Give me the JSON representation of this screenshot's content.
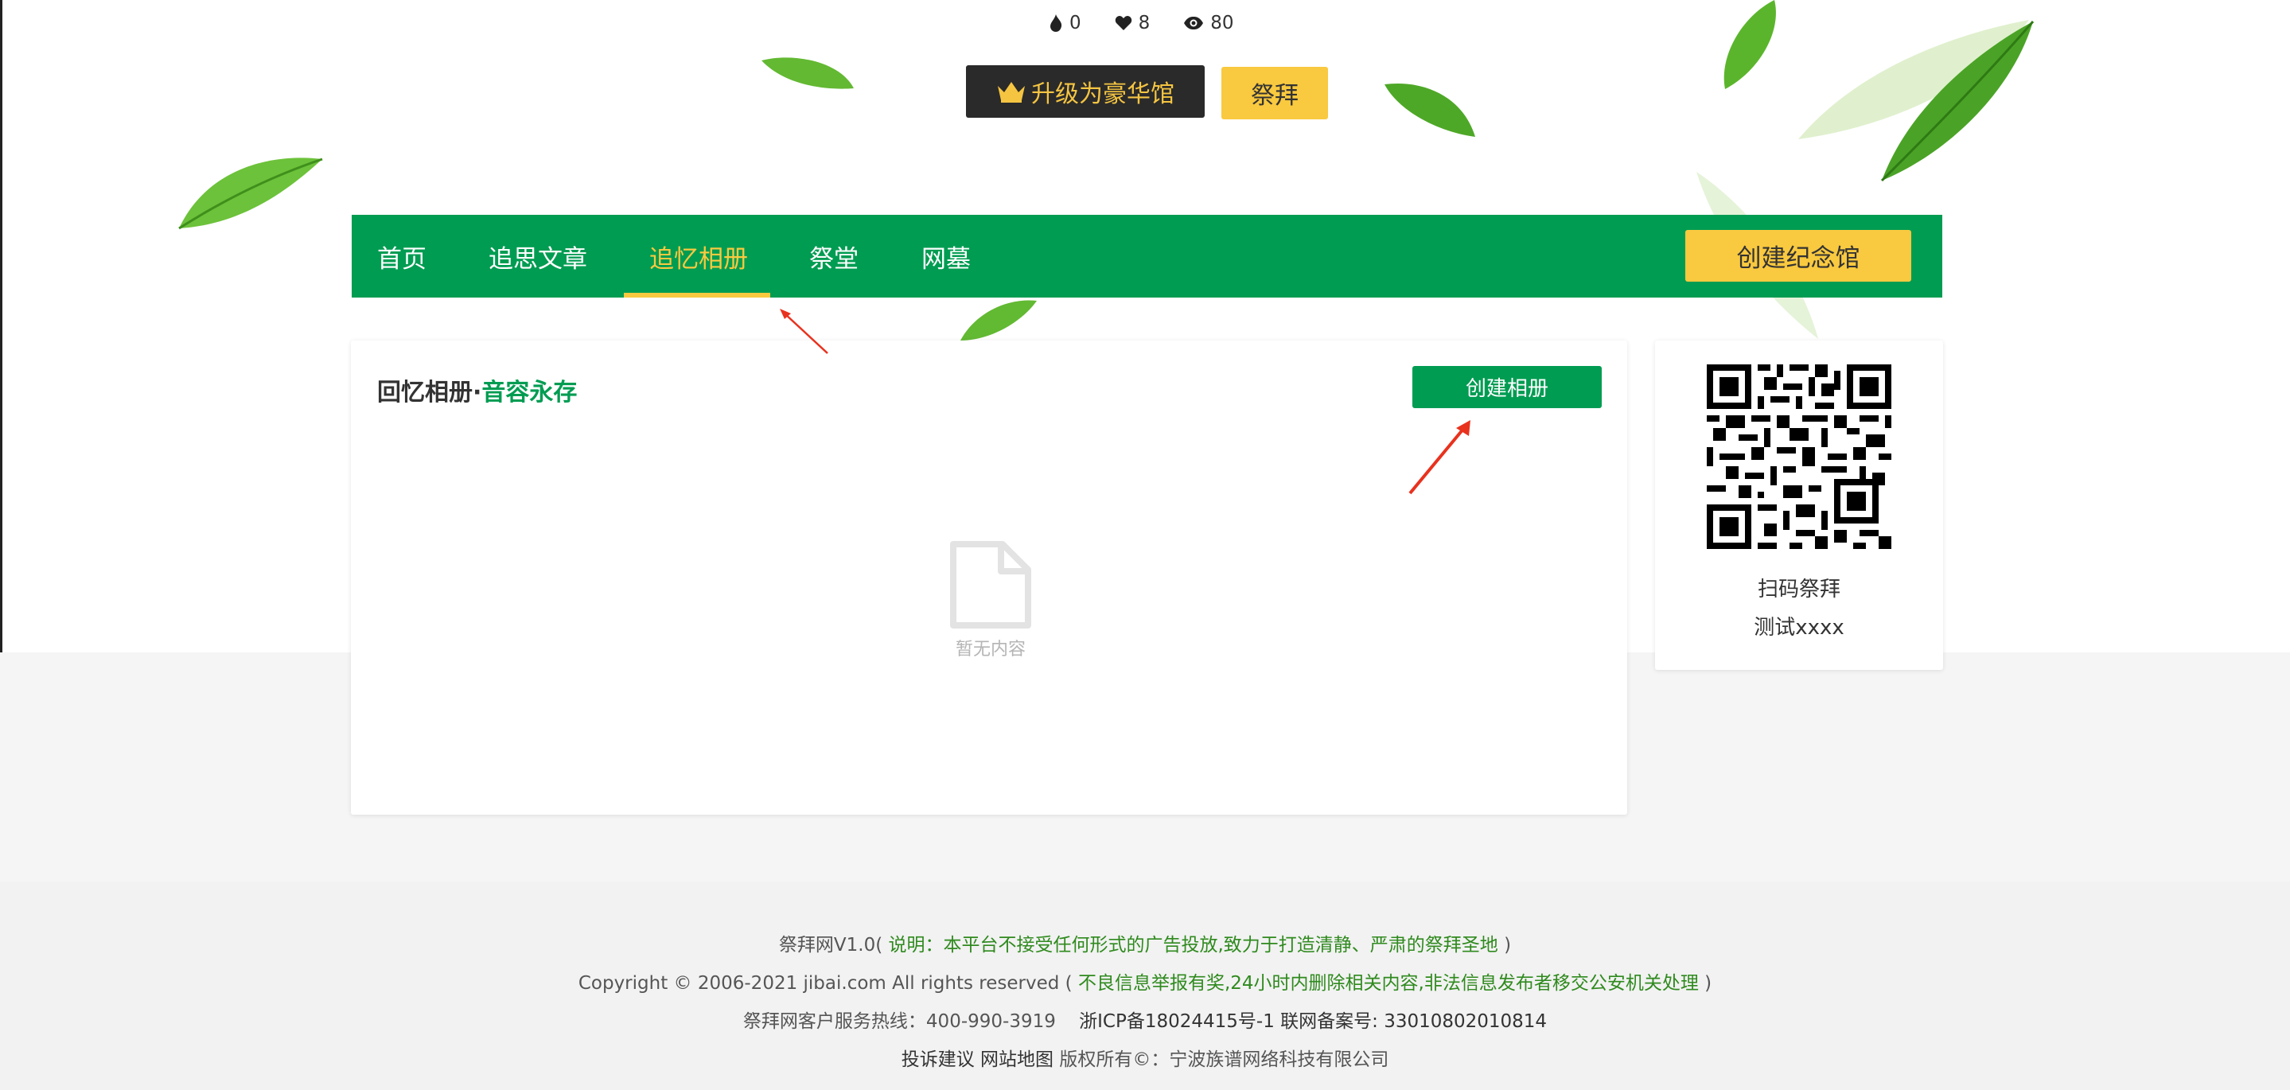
{
  "stats": {
    "incense": "0",
    "likes": "8",
    "views": "80"
  },
  "top_actions": {
    "upgrade_label": "升级为豪华馆",
    "worship_label": "祭拜"
  },
  "nav": {
    "items": [
      {
        "label": "首页"
      },
      {
        "label": "追思文章"
      },
      {
        "label": "追忆相册"
      },
      {
        "label": "祭堂"
      },
      {
        "label": "网墓"
      }
    ],
    "active": "追忆相册",
    "create_memorial_label": "创建纪念馆"
  },
  "album": {
    "title_main": "回忆相册·",
    "title_accent": "音容永存",
    "create_album_label": "创建相册",
    "empty_text": "暂无内容"
  },
  "sidebar": {
    "qr_caption": "扫码祭拜",
    "memorial_name": "测试xxxx"
  },
  "footer": {
    "line1_prefix": "祭拜网V1.0(",
    "line1_note": " 说明：本平台不接受任何形式的广告投放,致力于打造清静、严肃的祭拜圣地 ",
    "line1_suffix": ")",
    "line2_prefix": "Copyright © 2006-2021 jibai.com All rights reserved (",
    "line2_note": " 不良信息举报有奖,24小时内删除相关内容,非法信息发布者移交公安机关处理 ",
    "line2_suffix": ")",
    "hotline": "祭拜网客户服务热线：400-990-3919",
    "icp": "浙ICP备18024415号-1 联网备案号: 33010802010814",
    "complaint_link": "投诉建议",
    "sitemap_link": "网站地图",
    "copyright_owner": "版权所有©：宁波族谱网络科技有限公司"
  },
  "colors": {
    "brand_green": "#009c52",
    "accent_yellow": "#f9c93f",
    "dark_button": "#2a2a2a",
    "arrow_red": "#e8321e"
  }
}
